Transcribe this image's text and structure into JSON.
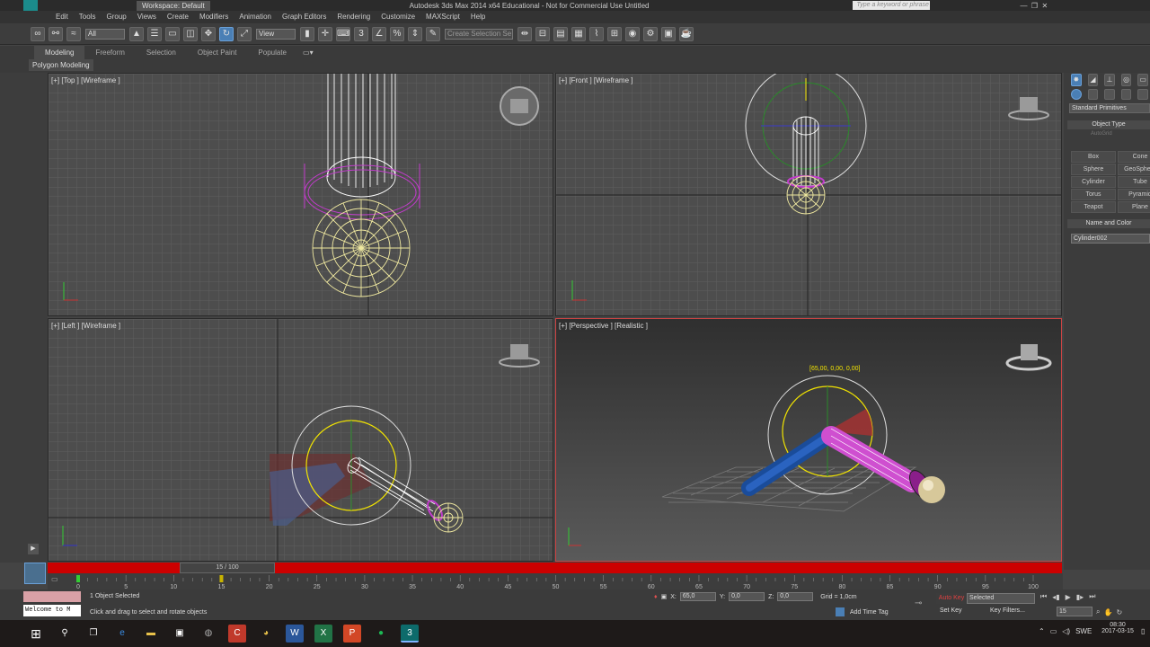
{
  "title": {
    "workspace": "Workspace: Default",
    "app": "Autodesk 3ds Max  2014 x64   Educational - Not for Commercial Use   Untitled",
    "search_placeholder": "Type a keyword or phrase"
  },
  "menu": [
    "Edit",
    "Tools",
    "Group",
    "Views",
    "Create",
    "Modifiers",
    "Animation",
    "Graph Editors",
    "Rendering",
    "Customize",
    "MAXScript",
    "Help"
  ],
  "toolbar": {
    "filter": "All",
    "refcoord": "View",
    "selection_set": "Create Selection Se"
  },
  "ribbon": {
    "tabs": [
      "Modeling",
      "Freeform",
      "Selection",
      "Object Paint",
      "Populate"
    ],
    "active": "Modeling",
    "sub": "Polygon Modeling"
  },
  "viewports": {
    "top": "[+] [Top ] [Wireframe ]",
    "front": "[+] [Front ] [Wireframe ]",
    "left": "[+] [Left ] [Wireframe ]",
    "perspective": "[+] [Perspective ] [Realistic ]",
    "coord_readout": "[65,00, 0,00, 0,00]"
  },
  "command_panel": {
    "dropdown": "Standard Primitives",
    "object_type": "Object Type",
    "autogrid": "AutoGrid",
    "buttons": [
      "Box",
      "Cone",
      "Sphere",
      "GeoSphere",
      "Cylinder",
      "Tube",
      "Torus",
      "Pyramid",
      "Teapot",
      "Plane"
    ],
    "name_color": "Name and Color",
    "object_name": "Cylinder002"
  },
  "timeline": {
    "frame": "15 / 100",
    "ticks": [
      "0",
      "5",
      "10",
      "15",
      "20",
      "25",
      "30",
      "35",
      "40",
      "45",
      "50",
      "55",
      "60",
      "65",
      "70",
      "75",
      "80",
      "85",
      "90",
      "95",
      "100"
    ]
  },
  "status": {
    "welcome": "Welcome to M",
    "selected": "1 Object Selected",
    "hint": "Click and drag to select and rotate objects",
    "x": "65,0",
    "y": "0,0",
    "z": "0,0",
    "grid": "Grid = 1,0cm",
    "add_time_tag": "Add Time Tag",
    "auto_key": "Auto Key",
    "set_key": "Set Key",
    "key_mode": "Selected",
    "key_filters": "Key Filters...",
    "frame_field": "15"
  },
  "taskbar": {
    "time": "08:30",
    "date": "2017-03-15",
    "lang": "SWE"
  },
  "colors": {
    "bg": "#4d4d4d",
    "active_border": "#cc4444",
    "timebar": "#cc0000",
    "wire_sel": "#f0e9a0",
    "gizmo_yellow": "#f2e400"
  }
}
